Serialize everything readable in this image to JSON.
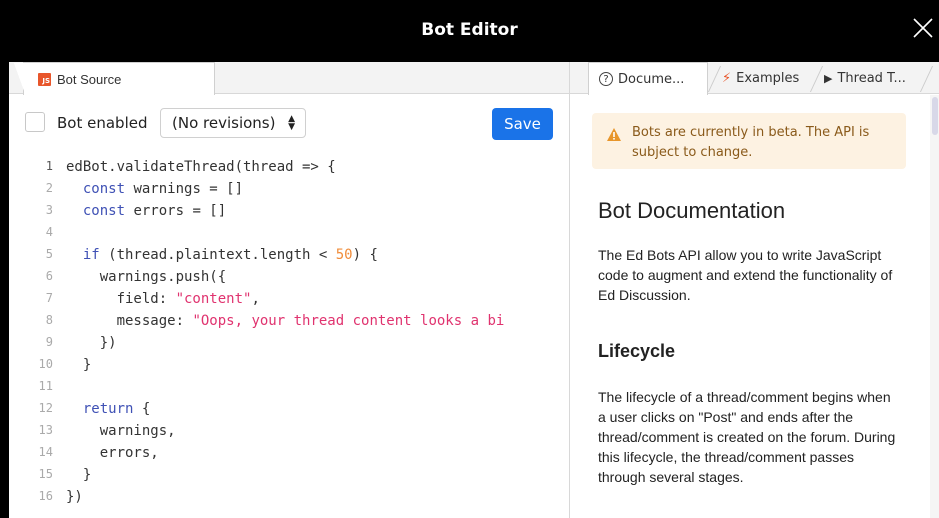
{
  "window": {
    "title": "Bot Editor",
    "close_icon": "close-icon"
  },
  "left_tabs": [
    {
      "label": "Bot Source",
      "icon": "js-file-icon",
      "icon_text": "JS"
    }
  ],
  "toolbar": {
    "bot_enabled_label": "Bot enabled",
    "bot_enabled_checked": false,
    "revisions_value": "(No revisions)",
    "save_label": "Save",
    "save_color": "#1a73e8"
  },
  "editor": {
    "lines": [
      {
        "n": "1",
        "tokens": [
          {
            "t": "edBot.validateThread(thread => {",
            "c": ""
          }
        ]
      },
      {
        "n": "2",
        "tokens": [
          {
            "t": "  ",
            "c": ""
          },
          {
            "t": "const",
            "c": "kw"
          },
          {
            "t": " warnings = []",
            "c": ""
          }
        ]
      },
      {
        "n": "3",
        "tokens": [
          {
            "t": "  ",
            "c": ""
          },
          {
            "t": "const",
            "c": "kw"
          },
          {
            "t": " errors = []",
            "c": ""
          }
        ]
      },
      {
        "n": "4",
        "tokens": []
      },
      {
        "n": "5",
        "tokens": [
          {
            "t": "  ",
            "c": ""
          },
          {
            "t": "if",
            "c": "kw"
          },
          {
            "t": " (thread.plaintext.length < ",
            "c": ""
          },
          {
            "t": "50",
            "c": "num"
          },
          {
            "t": ") {",
            "c": ""
          }
        ]
      },
      {
        "n": "6",
        "tokens": [
          {
            "t": "    warnings.push({",
            "c": ""
          }
        ]
      },
      {
        "n": "7",
        "tokens": [
          {
            "t": "      field: ",
            "c": ""
          },
          {
            "t": "\"content\"",
            "c": "str"
          },
          {
            "t": ",",
            "c": ""
          }
        ]
      },
      {
        "n": "8",
        "tokens": [
          {
            "t": "      message: ",
            "c": ""
          },
          {
            "t": "\"Oops, your thread content looks a bi",
            "c": "str"
          }
        ]
      },
      {
        "n": "9",
        "tokens": [
          {
            "t": "    })",
            "c": ""
          }
        ]
      },
      {
        "n": "10",
        "tokens": [
          {
            "t": "  }",
            "c": ""
          }
        ]
      },
      {
        "n": "11",
        "tokens": []
      },
      {
        "n": "12",
        "tokens": [
          {
            "t": "  ",
            "c": ""
          },
          {
            "t": "return",
            "c": "kw"
          },
          {
            "t": " {",
            "c": ""
          }
        ]
      },
      {
        "n": "13",
        "tokens": [
          {
            "t": "    warnings,",
            "c": ""
          }
        ]
      },
      {
        "n": "14",
        "tokens": [
          {
            "t": "    errors,",
            "c": ""
          }
        ]
      },
      {
        "n": "15",
        "tokens": [
          {
            "t": "  }",
            "c": ""
          }
        ]
      },
      {
        "n": "16",
        "tokens": [
          {
            "t": "})",
            "c": ""
          }
        ]
      }
    ]
  },
  "right_tabs": [
    {
      "label": "Docume...",
      "icon": "question-circle-icon",
      "glyph": "?"
    },
    {
      "label": "Examples",
      "icon": "lightning-icon",
      "glyph": "⚡"
    },
    {
      "label": "Thread T...",
      "icon": "play-icon",
      "glyph": "▶"
    }
  ],
  "docs": {
    "alert_text": "Bots are currently in beta. The API is subject to change.",
    "title": "Bot Documentation",
    "intro": "The Ed Bots API allow you to write JavaScript code to augment and extend the functionality of Ed Discussion.",
    "lifecycle_heading": "Lifecycle",
    "lifecycle_text": "The lifecycle of a thread/comment begins when a user clicks on \"Post\" and ends after the thread/comment is created on the forum. During this lifecycle, the thread/comment passes through several stages."
  }
}
